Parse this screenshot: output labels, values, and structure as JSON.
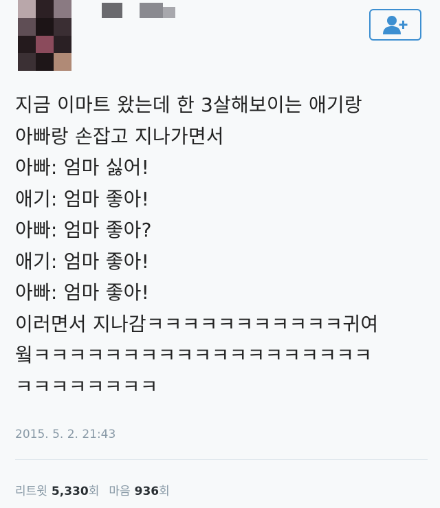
{
  "tweet": {
    "lines": [
      "지금 이마트 왔는데 한 3살해보이는 애기랑",
      "아빠랑 손잡고 지나가면서",
      "아빠: 엄마 싫어!",
      "애기: 엄마 좋아!",
      "아빠: 엄마 좋아?",
      "애기: 엄마 좋아!",
      "아빠: 엄마 좋아!",
      "이러면서 지나감ㅋㅋㅋㅋㅋㅋㅋㅋㅋㅋㅋ귀여",
      "웤ㅋㅋㅋㅋㅋㅋㅋㅋㅋㅋㅋㅋㅋㅋㅋㅋㅋㅋㅋ",
      "ㅋㅋㅋㅋㅋㅋㅋㅋ"
    ],
    "timestamp": "2015. 5. 2. 21:43"
  },
  "stats": {
    "retweet_label": "리트윗",
    "retweet_count": "5,330",
    "retweet_unit": "회",
    "like_label": "마음",
    "like_count": "936",
    "like_unit": "회"
  },
  "header": {
    "follow_icon": "add-user-icon"
  },
  "colors": {
    "accent": "#3d8fd1",
    "text": "#222222",
    "muted": "#8899a6",
    "background": "#f7f9fa"
  }
}
